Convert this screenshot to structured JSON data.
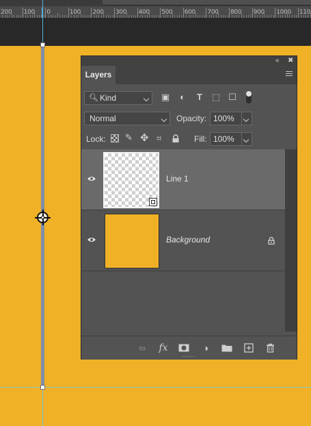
{
  "ruler": {
    "labels": [
      "200",
      "100",
      "0",
      "100",
      "200",
      "300",
      "400",
      "500",
      "600",
      "700",
      "800",
      "900",
      "1000",
      "1100"
    ]
  },
  "panel": {
    "tab_label": "Layers",
    "filter": {
      "kind_label": "Kind"
    },
    "blend_mode": "Normal",
    "opacity_label": "Opacity:",
    "opacity_value": "100%",
    "lock_label": "Lock:",
    "fill_label": "Fill:",
    "fill_value": "100%",
    "layers": [
      {
        "name": "Line 1",
        "visible": true,
        "selected": true,
        "type": "shape"
      },
      {
        "name": "Background",
        "visible": true,
        "selected": false,
        "locked": true,
        "type": "pixel"
      }
    ],
    "footer_icons": [
      "link-icon",
      "fx-icon",
      "mask-icon",
      "adjustment-icon",
      "folder-icon",
      "new-layer-icon",
      "trash-icon"
    ]
  },
  "colors": {
    "canvas": "#f0b127",
    "panel": "#535353",
    "selected_row": "#6a6a6a",
    "guide": "#5cc8ff"
  }
}
